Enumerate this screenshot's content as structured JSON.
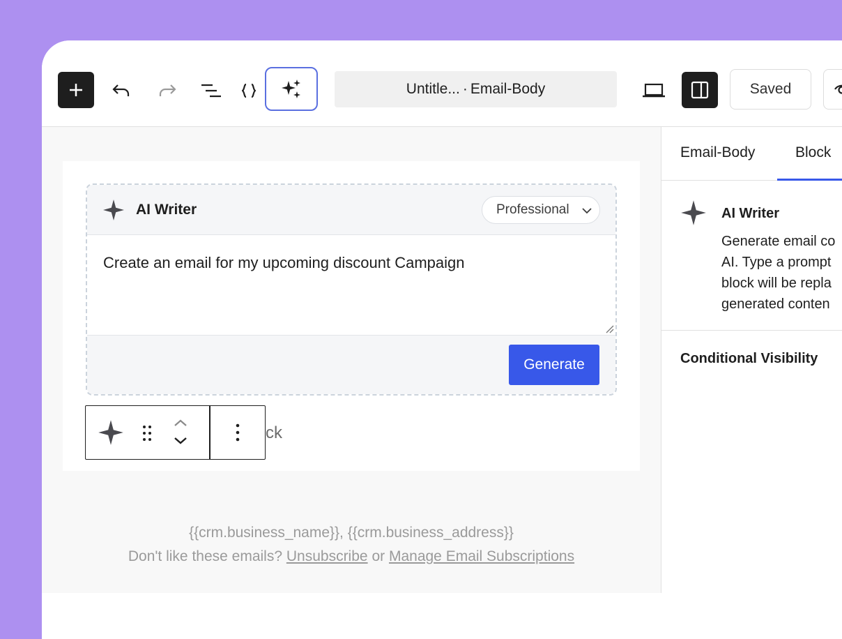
{
  "toolbar": {
    "doc_title": "Untitle...",
    "doc_separator": "·",
    "doc_template": "Email-Body",
    "saved_label": "Saved"
  },
  "ai_block": {
    "title": "AI Writer",
    "tone": "Professional",
    "prompt": "Create an email for my upcoming discount Campaign",
    "generate_label": "Generate"
  },
  "canvas": {
    "ghost_text": "ck",
    "footer_line1": "{{crm.business_name}}, {{crm.business_address}}",
    "footer_prefix": "Don't like these emails?",
    "unsubscribe": "Unsubscribe",
    "or": "or",
    "manage": "Manage Email Subscriptions"
  },
  "sidebar": {
    "tab_email": "Email-Body",
    "tab_block": "Block",
    "block_name": "AI Writer",
    "desc_line1": "Generate email co",
    "desc_line2": "AI. Type a prompt",
    "desc_line3": "block will be repla",
    "desc_line4": "generated conten",
    "conditional": "Conditional Visibility"
  },
  "icons": [
    "plus-icon",
    "undo-icon",
    "redo-icon",
    "list-view-icon",
    "code-icon",
    "ai-sparkles-icon",
    "desktop-preview-icon",
    "sidebar-toggle-icon",
    "eye-icon",
    "sparkle-icon",
    "chevron-down-icon",
    "drag-handle-icon",
    "move-up-down-icon",
    "more-vertical-icon"
  ],
  "colors": {
    "accent": "#3858e9",
    "background": "#ad90f0",
    "dark": "#1e1e1e"
  }
}
